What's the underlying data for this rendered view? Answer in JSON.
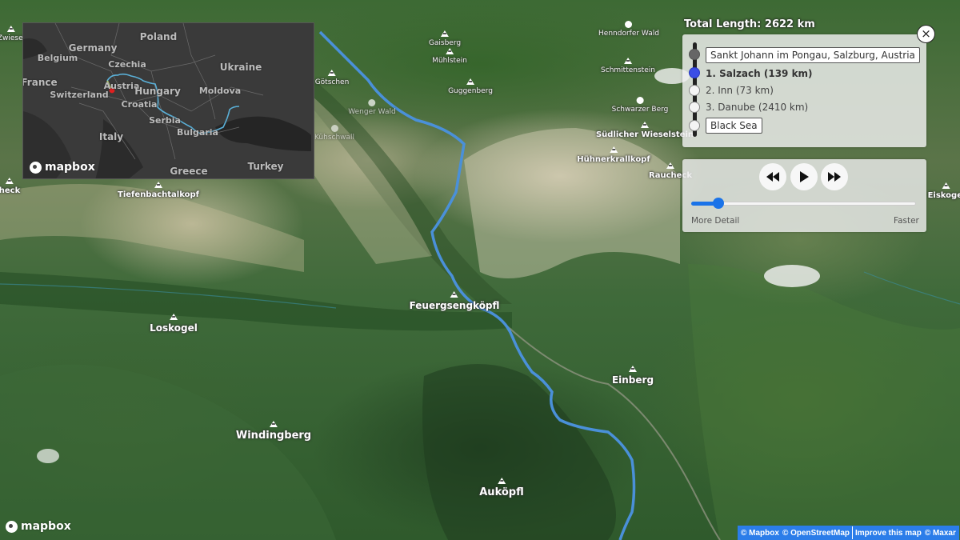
{
  "map": {
    "peaks": [
      {
        "name": "Feuergsengköpfl",
        "size": "normal"
      },
      {
        "name": "Loskogel",
        "size": "normal"
      },
      {
        "name": "Einberg",
        "size": "normal"
      },
      {
        "name": "Windingberg",
        "size": "large"
      },
      {
        "name": "Auköpfl",
        "size": "large"
      },
      {
        "name": "Tiefenbachtalkopf",
        "size": "small-bold"
      },
      {
        "name": "Hühnerkrallkopf",
        "size": "small-bold"
      },
      {
        "name": "Südlicher Wieselstein",
        "size": "small-bold"
      },
      {
        "name": "Rauchеck",
        "size": "small-bold"
      },
      {
        "name": "Eiskogel",
        "size": "small-bold"
      },
      {
        "name": "Gaisberg",
        "size": "small"
      },
      {
        "name": "Mühlstein",
        "size": "small"
      },
      {
        "name": "Guggenberg",
        "size": "small"
      },
      {
        "name": "Schmittenstein",
        "size": "small"
      },
      {
        "name": "Götschen",
        "size": "small"
      },
      {
        "name": "Zwiesel",
        "size": "small"
      },
      {
        "name": "heck",
        "size": "small-bold"
      }
    ],
    "forests": [
      {
        "name": "Henndorfer Wald"
      },
      {
        "name": "Schwarzer Berg"
      },
      {
        "name": "Wenger Wald"
      },
      {
        "name": "Kühschwall"
      }
    ],
    "logo_text": "mapbox"
  },
  "minimap": {
    "countries": [
      "Poland",
      "Germany",
      "Belgium",
      "Czechia",
      "France",
      "Austria",
      "Switzerland",
      "Hungary",
      "Ukraine",
      "Moldova",
      "Croatia",
      "Serbia",
      "Italy",
      "Bulgaria",
      "Greece",
      "Turkey"
    ],
    "logo_text": "mapbox",
    "route_color": "#5ab0d8",
    "position_color": "#e02020"
  },
  "route": {
    "total_length_label": "Total Length: 2622 km",
    "start": "Sankt Johann im Pongau, Salzburg, Austria",
    "segments": [
      {
        "label": "1. Salzach (139 km)",
        "active": true
      },
      {
        "label": "2. Inn (73 km)",
        "active": false
      },
      {
        "label": "3. Danube (2410 km)",
        "active": false
      }
    ],
    "end": "Black Sea",
    "close_icon": "×",
    "active_color": "#3b4ee6"
  },
  "playback": {
    "rewind": "rewind-icon",
    "play": "play-icon",
    "fast_forward": "fast-forward-icon",
    "slider_value": 0.12,
    "slider_min_label": "More Detail",
    "slider_max_label": "Faster",
    "accent_color": "#1a73e8"
  },
  "attribution": {
    "mapbox": "© Mapbox",
    "osm": "© OpenStreetMap",
    "improve": "Improve this map",
    "maxar": "© Maxar"
  }
}
